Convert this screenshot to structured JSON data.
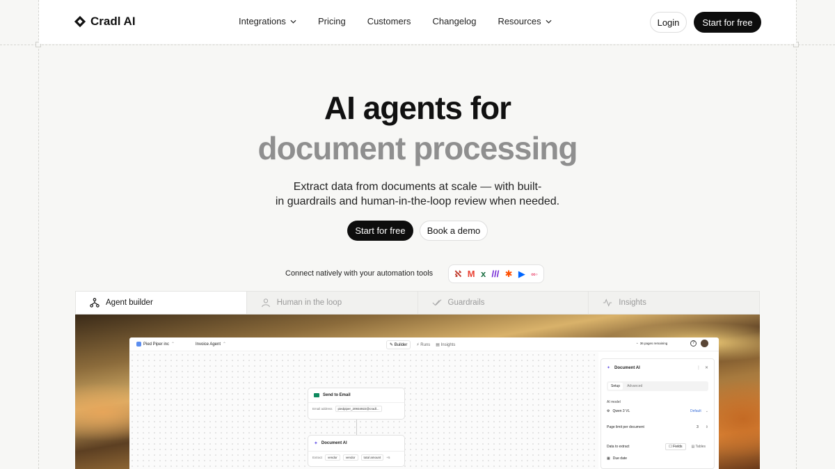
{
  "brand": {
    "name": "Cradl AI"
  },
  "nav": {
    "items": [
      {
        "label": "Integrations",
        "dropdown": true
      },
      {
        "label": "Pricing",
        "dropdown": false
      },
      {
        "label": "Customers",
        "dropdown": false
      },
      {
        "label": "Changelog",
        "dropdown": false
      },
      {
        "label": "Resources",
        "dropdown": true
      }
    ],
    "login": "Login",
    "start": "Start for free"
  },
  "hero": {
    "title_line1": "AI agents for",
    "title_line2": "document processing",
    "subtitle_line1": "Extract data from documents at scale — with built-",
    "subtitle_line2": "in guardrails and human-in-the-loop review when needed.",
    "cta_primary": "Start for free",
    "cta_secondary": "Book a demo",
    "connect_text": "Connect natively with your automation tools"
  },
  "tabs": [
    {
      "label": "Agent builder",
      "icon": "agent-builder-icon",
      "active": true
    },
    {
      "label": "Human in the loop",
      "icon": "person-icon",
      "active": false
    },
    {
      "label": "Guardrails",
      "icon": "check-icon",
      "active": false
    },
    {
      "label": "Insights",
      "icon": "activity-icon",
      "active": false
    }
  ],
  "app": {
    "org": "Pied Piper inc",
    "agent": "Invoice Agent",
    "tabs": [
      "Builder",
      "Runs",
      "Insights"
    ],
    "pages_remaining": "36 pages remaining",
    "nodes": {
      "email": {
        "title": "Send to Email",
        "label": "Email address",
        "value": "piedpiper_20934922@cradl..."
      },
      "docai": {
        "title": "Document AI",
        "label": "Extract",
        "chips": [
          "vendor",
          "vendor",
          "total amount"
        ],
        "more": "+5"
      }
    },
    "panel": {
      "title": "Document AI",
      "tabs": [
        "Setup",
        "Advanced"
      ],
      "ai_model_label": "AI model",
      "ai_model_value": "Qwen 3 VL",
      "ai_model_badge": "Default",
      "page_limit_label": "Page limit per document",
      "page_limit_value": "3",
      "extract_label": "Data to extract",
      "extract_opt1": "Fields",
      "extract_opt2": "Tables",
      "field1": "Due date"
    }
  },
  "colors": {
    "accent": "#0d0d0d",
    "muted": "#8f8f8f",
    "page_bg": "#f7f7f5"
  }
}
